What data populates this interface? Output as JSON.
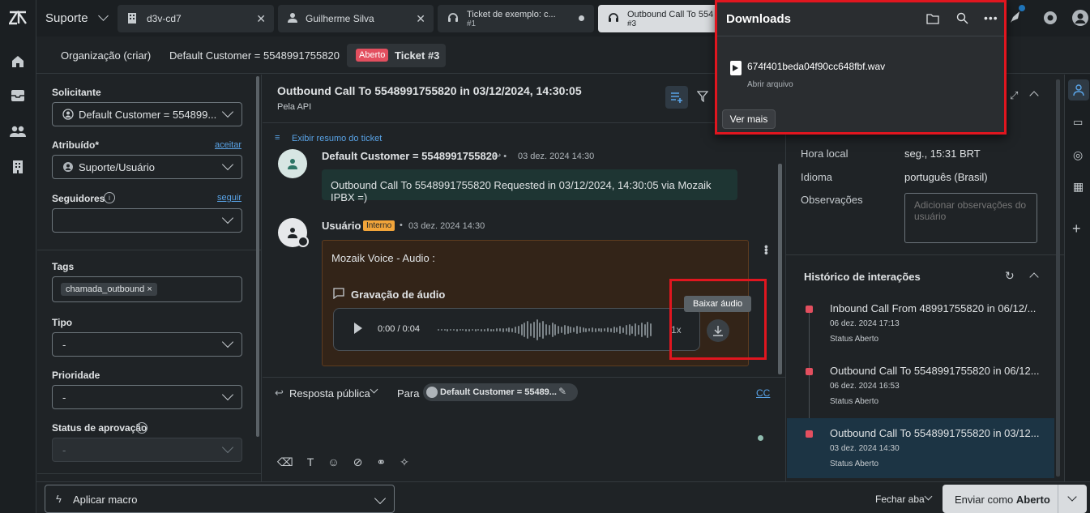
{
  "app": {
    "workspace": "Suporte"
  },
  "tabs": [
    {
      "label": "d3v-cd7",
      "sub": ""
    },
    {
      "label": "Guilherme Silva",
      "sub": ""
    },
    {
      "label": "Ticket de exemplo: c...",
      "sub": "#1"
    },
    {
      "label": "Outbound Call To 554",
      "sub": "#3"
    }
  ],
  "breadcrumb": {
    "org": "Organização (criar)",
    "customer": "Default Customer = 5548991755820",
    "status_badge": "Aberto",
    "ticket": "Ticket #3"
  },
  "left": {
    "requester_label": "Solicitante",
    "requester_value": "Default Customer = 554899...",
    "assignee_label": "Atribuído*",
    "assignee_link": "aceitar",
    "assignee_value": "Suporte/Usuário",
    "followers_label": "Seguidores",
    "followers_link": "seguir",
    "tags_label": "Tags",
    "tag": "chamada_outbound",
    "type_label": "Tipo",
    "type_value": "-",
    "priority_label": "Prioridade",
    "priority_value": "-",
    "approval_label": "Status de aprovação",
    "approval_value": "-"
  },
  "ticket": {
    "title": "Outbound Call To 5548991755820 in 03/12/2024, 14:30:05",
    "via": "Pela API",
    "summary_link": "Exibir resumo do ticket",
    "msg1_author": "Default Customer = 5548991755820",
    "msg1_time": "03 dez. 2024 14:30",
    "msg1_body": "Outbound Call To 5548991755820 Requested in 03/12/2024, 14:30:05 via Mozaik IPBX =)",
    "msg2_author": "Usuário",
    "msg2_badge": "Interno",
    "msg2_time": "03 dez. 2024 14:30",
    "msg2_body": "Mozaik Voice - Audio :",
    "audio_title": "Gravação de áudio",
    "audio_time": "0:00 / 0:04",
    "audio_speed": "1x",
    "tooltip": "Baixar áudio"
  },
  "reply": {
    "mode": "Resposta pública",
    "to_label": "Para",
    "to_value": "Default Customer = 55489...",
    "cc": "CC"
  },
  "right": {
    "local_time_label": "Hora local",
    "local_time_value": "seg., 15:31 BRT",
    "language_label": "Idioma",
    "language_value": "português (Brasil)",
    "notes_label": "Observações",
    "notes_placeholder": "Adicionar observações do usuário",
    "history_title": "Histórico de interações",
    "history": [
      {
        "title": "Inbound Call From 48991755820 in 06/12/...",
        "date": "06 dez. 2024 17:13",
        "status": "Status Aberto"
      },
      {
        "title": "Outbound Call To 5548991755820 in 06/12...",
        "date": "06 dez. 2024 16:53",
        "status": "Status Aberto"
      },
      {
        "title": "Outbound Call To 5548991755820 in 03/12...",
        "date": "03 dez. 2024 14:30",
        "status": "Status Aberto"
      }
    ]
  },
  "footer": {
    "macro": "Aplicar macro",
    "close_tab": "Fechar aba",
    "submit_prefix": "Enviar como ",
    "submit_status": "Aberto"
  },
  "downloads": {
    "title": "Downloads",
    "file": "674f401beda04f90cc648fbf.wav",
    "open": "Abrir arquivo",
    "more": "Ver mais"
  },
  "colors": {
    "accent": "#59a3e6",
    "open_badge": "#e34f5f",
    "internal_badge": "#f2a53a",
    "highlight": "#e0161f"
  }
}
